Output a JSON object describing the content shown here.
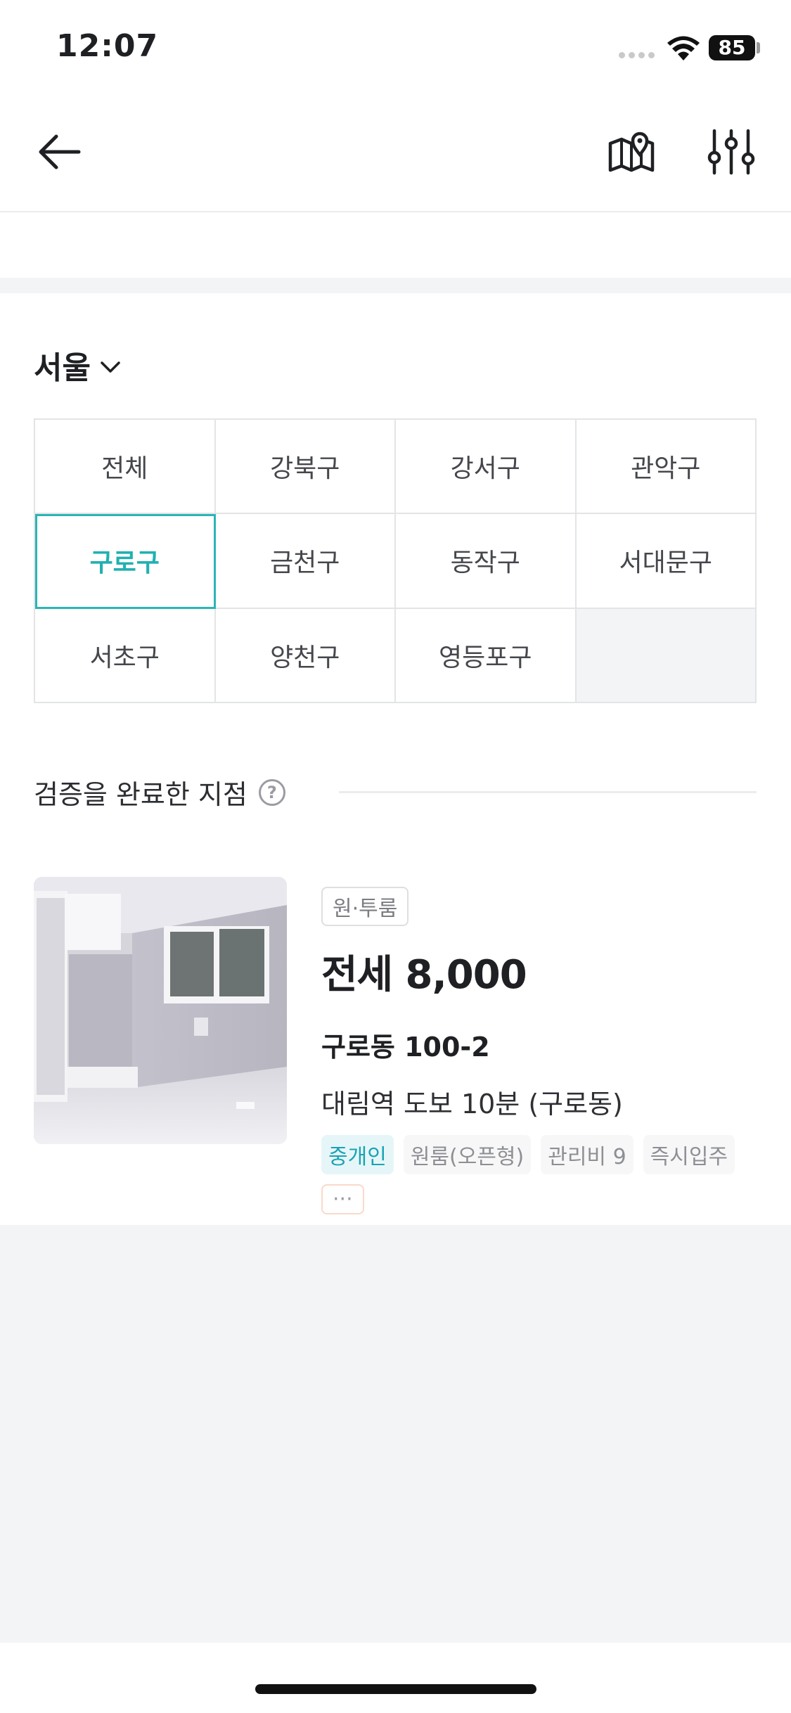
{
  "status_bar": {
    "time": "12:07",
    "battery": "85"
  },
  "nav": {
    "back": "back-arrow-icon",
    "map": "map-pin-icon",
    "filter": "filter-sliders-icon"
  },
  "region": {
    "city": "서울",
    "districts": [
      {
        "label": "전체"
      },
      {
        "label": "강북구"
      },
      {
        "label": "강서구"
      },
      {
        "label": "관악구"
      },
      {
        "label": "구로구",
        "selected": true
      },
      {
        "label": "금천구"
      },
      {
        "label": "동작구"
      },
      {
        "label": "서대문구"
      },
      {
        "label": "서초구"
      },
      {
        "label": "양천구"
      },
      {
        "label": "영등포구"
      },
      {
        "label": ""
      }
    ]
  },
  "verified": {
    "title": "검증을 완료한 지점",
    "help": "?"
  },
  "listing": {
    "type": "원·투룸",
    "price": "전세 8,000",
    "address": "구로동 100-2",
    "description": "대림역 도보 10분 (구로동)",
    "tags": [
      "중개인",
      "원룸(오픈형)",
      "관리비 9",
      "즉시입주"
    ],
    "more": "···"
  },
  "colors": {
    "accent": "#22b0b0",
    "agent_tag_bg": "#e6f6f8"
  }
}
